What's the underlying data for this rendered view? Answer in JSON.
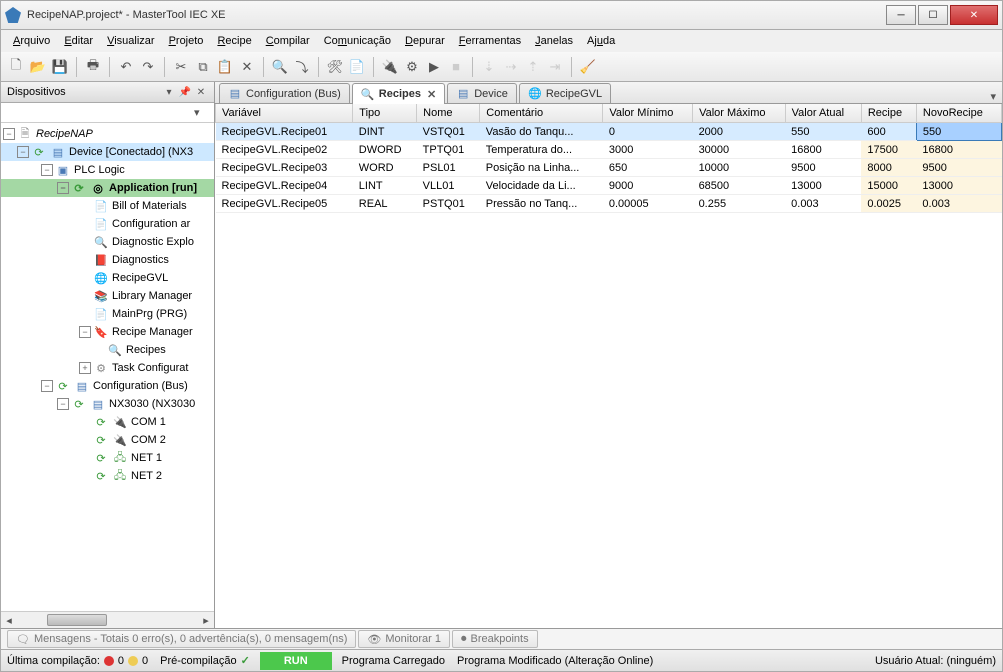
{
  "window": {
    "title": "RecipeNAP.project* - MasterTool IEC XE"
  },
  "menu": {
    "items": [
      "Arquivo",
      "Editar",
      "Visualizar",
      "Projeto",
      "Recipe",
      "Compilar",
      "Comunicação",
      "Depurar",
      "Ferramentas",
      "Janelas",
      "Ajuda"
    ]
  },
  "left_panel": {
    "title": "Dispositivos",
    "tree": {
      "root": "RecipeNAP",
      "device": "Device [Conectado] (NX3",
      "plc": "PLC Logic",
      "app": "Application [run]",
      "bill": "Bill of Materials",
      "confar": "Configuration ar",
      "diag_expl": "Diagnostic Explo",
      "diag": "Diagnostics",
      "recipegvl": "RecipeGVL",
      "lib": "Library Manager",
      "mainprg": "MainPrg (PRG)",
      "recipe_mgr": "Recipe Manager",
      "recipes": "Recipes",
      "task": "Task Configurat",
      "conf_bus": "Configuration (Bus)",
      "nx3030": "NX3030 (NX3030",
      "com1": "COM 1",
      "com2": "COM 2",
      "net1": "NET 1",
      "net2": "NET 2"
    }
  },
  "tabs": {
    "t0": "Configuration (Bus)",
    "t1": "Recipes",
    "t2": "Device",
    "t3": "RecipeGVL"
  },
  "grid": {
    "headers": [
      "Variável",
      "Tipo",
      "Nome",
      "Comentário",
      "Valor Mínimo",
      "Valor Máximo",
      "Valor Atual",
      "Recipe",
      "NovoRecipe"
    ],
    "rows": [
      {
        "var": "RecipeGVL.Recipe01",
        "tipo": "DINT",
        "nome": "VSTQ01",
        "com": "Vasão do Tanqu...",
        "min": "0",
        "max": "2000",
        "atual": "550",
        "recipe": "600",
        "novo": "550"
      },
      {
        "var": "RecipeGVL.Recipe02",
        "tipo": "DWORD",
        "nome": "TPTQ01",
        "com": "Temperatura do...",
        "min": "3000",
        "max": "30000",
        "atual": "16800",
        "recipe": "17500",
        "novo": "16800"
      },
      {
        "var": "RecipeGVL.Recipe03",
        "tipo": "WORD",
        "nome": "PSL01",
        "com": "Posição na Linha...",
        "min": "650",
        "max": "10000",
        "atual": "9500",
        "recipe": "8000",
        "novo": "9500"
      },
      {
        "var": "RecipeGVL.Recipe04",
        "tipo": "LINT",
        "nome": "VLL01",
        "com": "Velocidade da Li...",
        "min": "9000",
        "max": "68500",
        "atual": "13000",
        "recipe": "15000",
        "novo": "13000"
      },
      {
        "var": "RecipeGVL.Recipe05",
        "tipo": "REAL",
        "nome": "PSTQ01",
        "com": "Pressão no Tanq...",
        "min": "0.00005",
        "max": "0.255",
        "atual": "0.003",
        "recipe": "0.0025",
        "novo": "0.003"
      }
    ]
  },
  "bottom_tabs": {
    "msgs": "Mensagens - Totais 0 erro(s), 0 advertência(s), 0 mensagem(ns)",
    "monitor": "Monitorar 1",
    "breakpoints": "Breakpoints"
  },
  "status": {
    "lastcomp": "Última compilação:",
    "err": "0",
    "warn": "0",
    "precomp": "Pré-compilação",
    "run": "RUN",
    "loaded": "Programa Carregado",
    "modified": "Programa Modificado (Alteração Online)",
    "user": "Usuário Atual: (ninguém)"
  }
}
